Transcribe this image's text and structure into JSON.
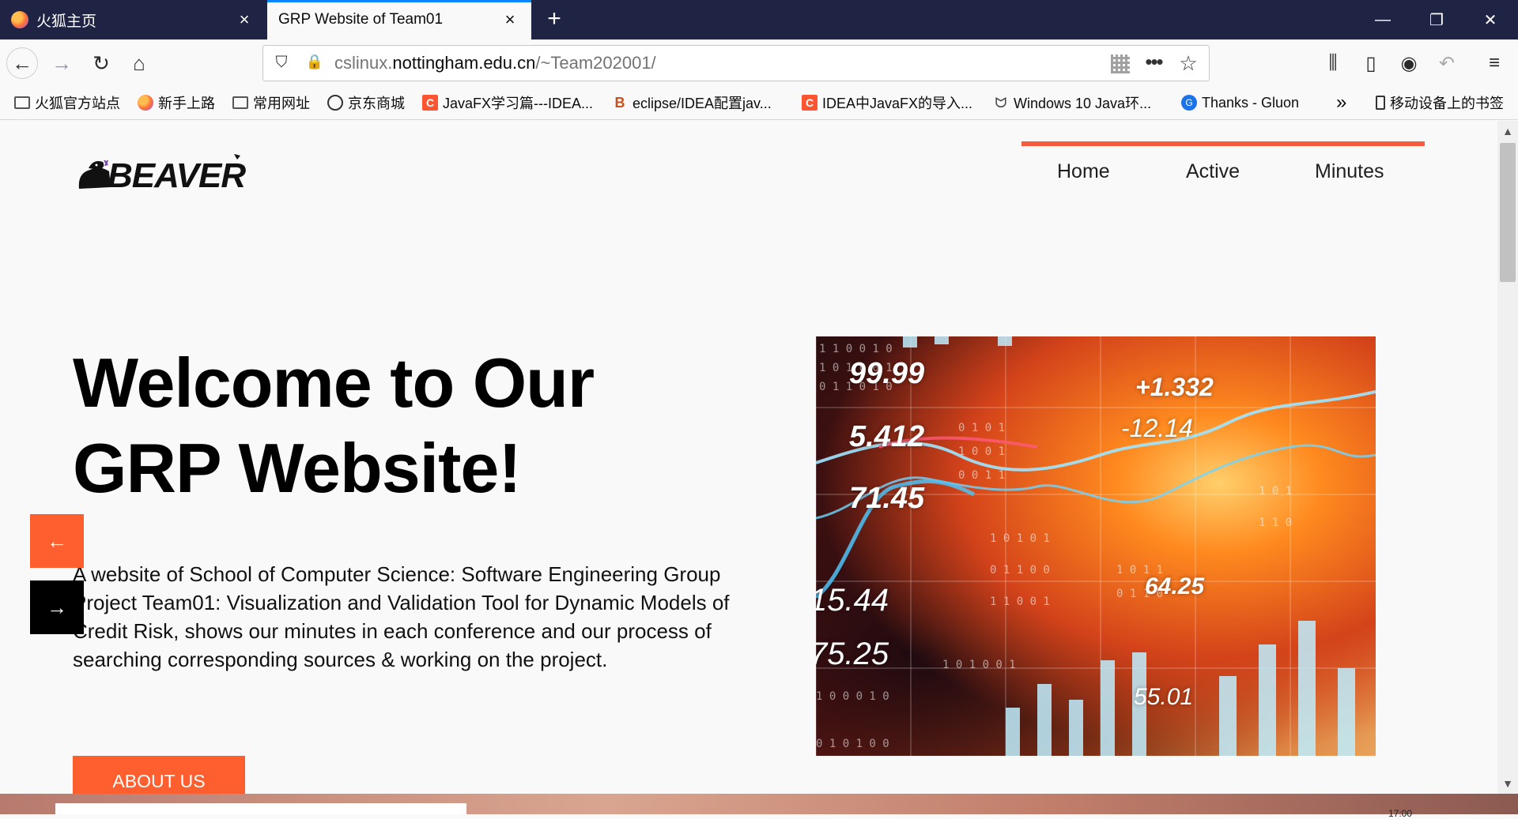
{
  "browser": {
    "tabs": [
      {
        "label": "火狐主页",
        "close": "×"
      },
      {
        "label": "GRP Website of Team01",
        "close": "×"
      }
    ],
    "new_tab": "+",
    "window_controls": {
      "minimize": "—",
      "restore": "❐",
      "close": "✕"
    },
    "url": {
      "prefix": "cslinux.",
      "domain": "nottingham.edu.cn",
      "path": "/~Team202001/"
    },
    "bookmarks": [
      "火狐官方站点",
      "新手上路",
      "常用网址",
      "京东商城",
      "JavaFX学习篇---IDEA...",
      "eclipse/IDEA配置jav...",
      "IDEA中JavaFX的导入...",
      "Windows 10 Java环...",
      "Thanks - Gluon",
      "移动设备上的书签"
    ],
    "bookmarks_overflow": "»",
    "icons": {
      "back": "←",
      "forward": "→",
      "reload": "↻",
      "home": "⌂",
      "shield": "⛉",
      "more": "•••",
      "star": "☆",
      "library": "⫼",
      "sidebar": "▯",
      "account": "◉",
      "undo": "↶",
      "menu": "≡"
    }
  },
  "site": {
    "logo_text": "BEAVER",
    "nav": [
      "Home",
      "Active",
      "Minutes"
    ],
    "hero_title_line1": "Welcome to Our",
    "hero_title_line2": "GRP Website!",
    "hero_description": "A website of School of Computer Science: Software Engineering Group Project Team01: Visualization and Validation Tool for Dynamic Models of Credit Risk, shows our minutes in each conference and our process of searching corresponding sources & working on the project.",
    "about_button": "ABOUT US",
    "slider_prev": "←",
    "slider_next": "→",
    "image_numbers": [
      "99.99",
      "5.412",
      "71.45",
      "15.44",
      "75.25",
      "+1.332",
      "-12.14",
      "64.25",
      "55.01"
    ],
    "accent_color": "#ff5f2e"
  },
  "taskbar": {
    "time_partial": "17:00"
  }
}
